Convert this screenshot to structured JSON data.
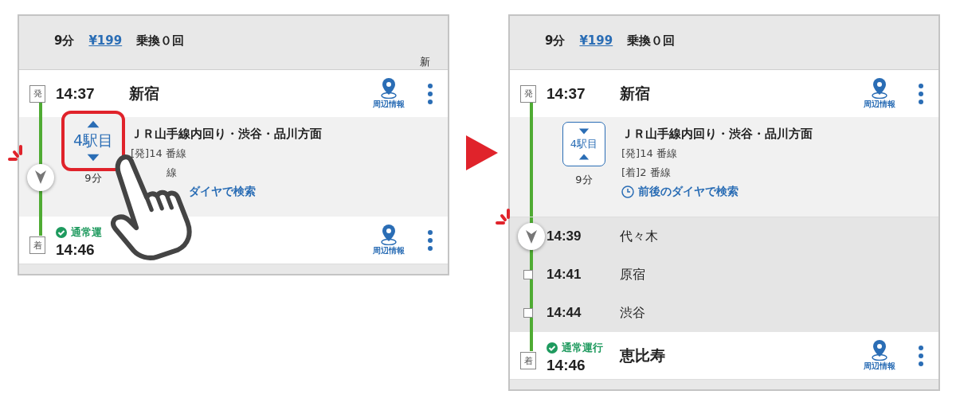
{
  "panels": [
    {
      "kind": "tapped",
      "summary": {
        "duration": "9分",
        "fare": "¥199",
        "transfers": "乗換０回",
        "extra": "新"
      },
      "departure": {
        "badge": "発",
        "time": "14:37",
        "station": "新宿",
        "info_label": "周辺情報"
      },
      "segment": {
        "stops_button": "4駅目",
        "expanded": false,
        "highlighted": true,
        "current": true,
        "duration": "9分",
        "line": "ＪＲ山手線内回り・渋谷・品川方面",
        "platforms": [
          "[発]14 番線",
          "線"
        ],
        "search_link": "ダイヤで検索"
      },
      "arrival": {
        "badge": "着",
        "time": "14:46",
        "status": "通常運",
        "info_label": "周辺情報"
      }
    },
    {
      "kind": "expanded",
      "summary": {
        "duration": "9分",
        "fare": "¥199",
        "transfers": "乗換０回"
      },
      "departure": {
        "badge": "発",
        "time": "14:37",
        "station": "新宿",
        "info_label": "周辺情報"
      },
      "segment": {
        "stops_button": "4駅目",
        "expanded": true,
        "highlighted": false,
        "current": false,
        "duration": "9分",
        "line": "ＪＲ山手線内回り・渋谷・品川方面",
        "platforms": [
          "[発]14 番線",
          "[着]2 番線"
        ],
        "search_link": "前後のダイヤで検索"
      },
      "stops": [
        {
          "time": "14:39",
          "station": "代々木",
          "current": true
        },
        {
          "time": "14:41",
          "station": "原宿",
          "current": false
        },
        {
          "time": "14:44",
          "station": "渋谷",
          "current": false
        }
      ],
      "arrival": {
        "badge": "着",
        "time": "14:46",
        "status": "通常運行",
        "station": "恵比寿",
        "info_label": "周辺情報"
      }
    }
  ]
}
